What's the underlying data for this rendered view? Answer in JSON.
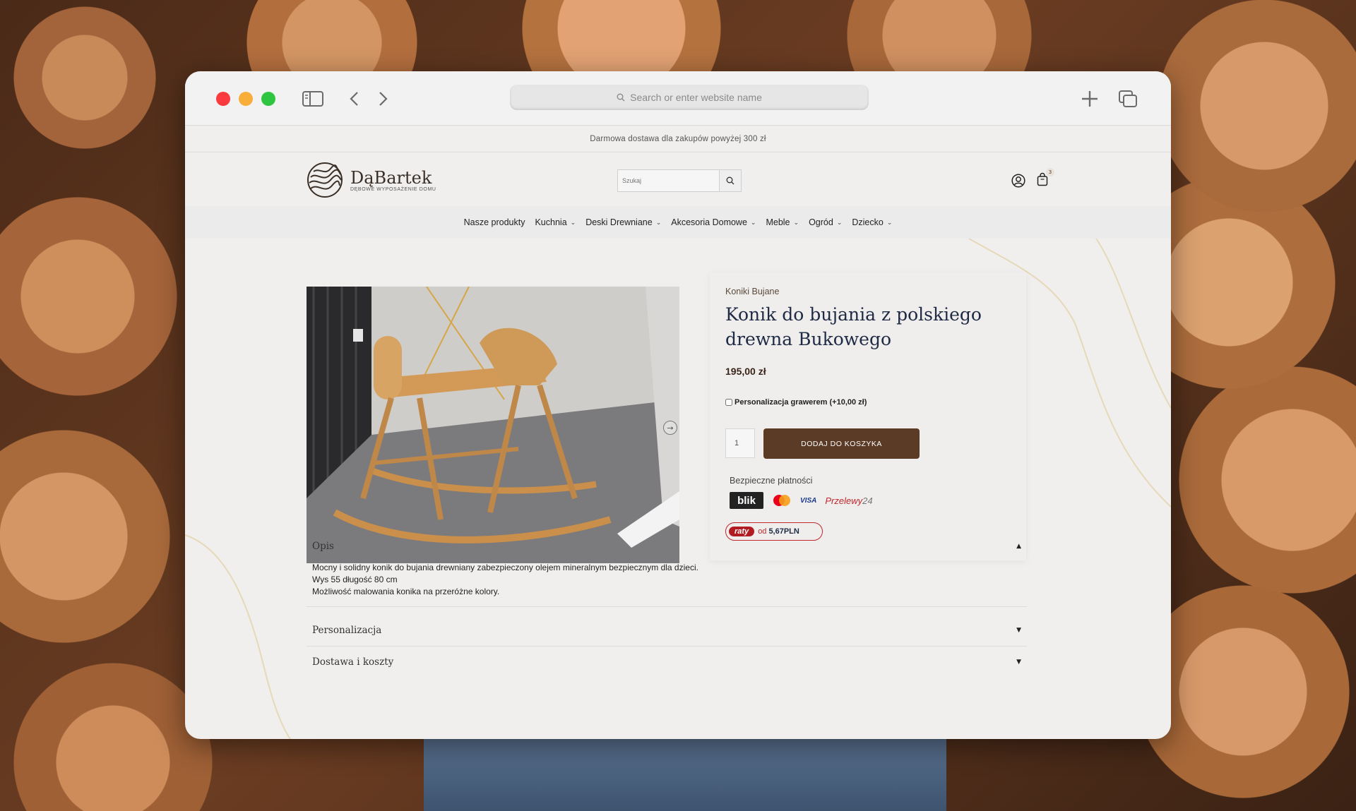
{
  "browser": {
    "address_placeholder": "Search or enter website name"
  },
  "site": {
    "promo": "Darmowa dostawa dla zakupów powyżej 300 zł",
    "logo_name": "DąBartek",
    "logo_tagline": "DĘBOWE WYPOSAŻENIE DOMU",
    "search_placeholder": "Szukaj",
    "cart_count": "3",
    "nav": [
      {
        "label": "Nasze produkty",
        "dropdown": false
      },
      {
        "label": "Kuchnia",
        "dropdown": true
      },
      {
        "label": "Deski Drewniane",
        "dropdown": true
      },
      {
        "label": "Akcesoria Domowe",
        "dropdown": true
      },
      {
        "label": "Meble",
        "dropdown": true
      },
      {
        "label": "Ogród",
        "dropdown": true
      },
      {
        "label": "Dziecko",
        "dropdown": true
      }
    ]
  },
  "product": {
    "category": "Koniki Bujane",
    "title": "Konik do bujania z polskiego drewna Bukowego",
    "price": "195,00 zł",
    "option_label": "Personalizacja grawerem (+10,00 zł)",
    "quantity": "1",
    "add_to_cart": "DODAJ DO KOSZYKA",
    "payments_label": "Bezpieczne płatności",
    "payment_logos": {
      "blik": "blik",
      "visa": "VISA",
      "p24_main": "Przelewy",
      "p24_num": "24"
    },
    "raty": {
      "badge": "raty",
      "od": "od",
      "value": "5,67PLN"
    }
  },
  "accordion": {
    "opis": {
      "title": "Opis",
      "line1": "Mocny i solidny konik do bujania drewniany zabezpieczony olejem mineralnym bezpiecznym dla dzieci.",
      "line2": "Wys 55 długość 80 cm",
      "line3": "Możliwość malowania konika na przeróżne kolory."
    },
    "personalizacja": {
      "title": "Personalizacja"
    },
    "dostawa": {
      "title": "Dostawa i koszty"
    }
  }
}
